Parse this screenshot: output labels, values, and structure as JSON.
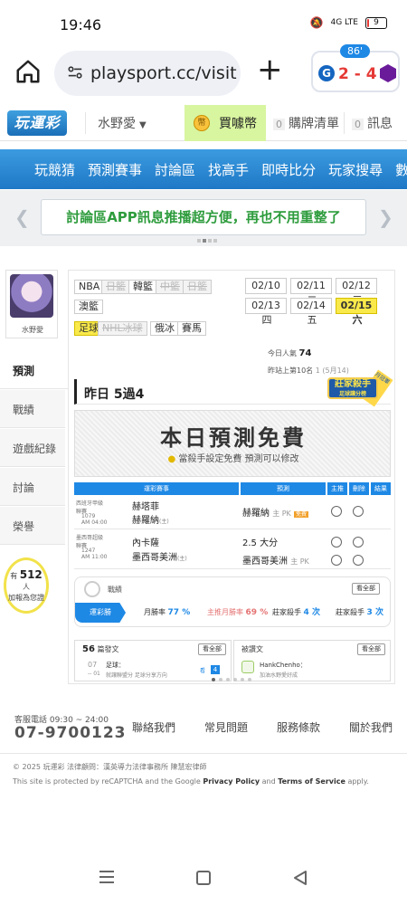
{
  "status_bar": {
    "time": "19:46",
    "battery": "9",
    "battery_level": 0.09,
    "signal_text": "4G LTE"
  },
  "browser": {
    "url": "playsport.cc/visit",
    "score": {
      "minute": "86'",
      "home_score": "2",
      "away_score": "4",
      "home_logo": "G"
    }
  },
  "header": {
    "logo_text": "玩運彩",
    "username": "水野愛",
    "coin_label": "買噱幣",
    "cart_count": "0",
    "cart_label": "購牌清單",
    "msg_count": "0",
    "msg_label": "訊息"
  },
  "nav": {
    "items": [
      {
        "label": "玩競猜"
      },
      {
        "label": "預測賽事"
      },
      {
        "label": "討論區"
      },
      {
        "label": "找高手"
      },
      {
        "label": "即時比分"
      },
      {
        "label": "玩家搜尋"
      },
      {
        "label": "數據"
      }
    ]
  },
  "banner": {
    "text": "討論區APP訊息推播超方便，再也不用重整了"
  },
  "sidebar": {
    "username": "水野愛",
    "items": [
      {
        "label": "預測",
        "active": true
      },
      {
        "label": "戰績",
        "active": false
      },
      {
        "label": "遊戲紀錄",
        "active": false
      },
      {
        "label": "討論",
        "active": false
      },
      {
        "label": "榮譽",
        "active": false
      }
    ],
    "online_prefix": "有",
    "online_count": "512",
    "online_unit": "人",
    "online_suffix": "加報為您證"
  },
  "categories": [
    {
      "label": "NBA",
      "state": "normal"
    },
    {
      "label": "日籃",
      "state": "disabled"
    },
    {
      "label": "韓籃",
      "state": "normal"
    },
    {
      "label": "中籃",
      "state": "disabled"
    },
    {
      "label": "日籃",
      "state": "disabled"
    },
    {
      "label": "澳籃",
      "state": "normal"
    },
    {
      "label": "足球",
      "state": "selected"
    },
    {
      "label": "NHL冰球",
      "state": "disabled"
    },
    {
      "label": "俄冰",
      "state": "normal"
    },
    {
      "label": "賽馬",
      "state": "normal"
    }
  ],
  "dates": [
    {
      "date": "02/10",
      "day": "一",
      "selected": false
    },
    {
      "date": "02/11",
      "day": "二",
      "selected": false
    },
    {
      "date": "02/12",
      "day": "三",
      "selected": false
    },
    {
      "date": "02/13",
      "day": "四",
      "selected": false
    },
    {
      "date": "02/14",
      "day": "五",
      "selected": false
    },
    {
      "date": "02/15",
      "day": "六",
      "selected": true
    }
  ],
  "stats": {
    "today_label": "今日人氣",
    "today_value": "74",
    "rank_label": "昨站上第10名",
    "rank_extra": "1 (5月14)"
  },
  "yesterday": {
    "text": "昨日 5過4"
  },
  "badge": {
    "line1": "莊家殺手",
    "line2": "足球讓分榜",
    "ribbon": "月冠軍榜"
  },
  "free_box": {
    "title": "本日預測免費",
    "subtitle": "當殺手設定免費  預測可以修改"
  },
  "table": {
    "headers": [
      "運彩賽事",
      "預測",
      "主推",
      "刪除",
      "結果"
    ],
    "rows": [
      {
        "league": "西班牙甲級聯賽",
        "id_time": "1079\nAM 04:00",
        "home": "赫塔菲",
        "away": "赫羅納",
        "away_tag": "(主)",
        "pick": "赫羅納",
        "pick_tag": "主 PK",
        "badge": "免費"
      },
      {
        "league": "墨西哥超級聯賽",
        "id_time": "1247\nAM 11:00",
        "home": "內卡薩",
        "away": "墨西哥美洲",
        "away_tag": "(主)",
        "pick": "2.5 大分",
        "pick2": "墨西哥美洲",
        "pick2_tag": "主 PK"
      }
    ]
  },
  "record": {
    "label": "戰績",
    "see_all": "看全部",
    "tags": [
      {
        "label": "運彩勝",
        "value": ""
      },
      {
        "label": "月勝率",
        "value": "77 %"
      },
      {
        "label": "主推月勝率",
        "value": "69 %"
      },
      {
        "label": "莊家殺手",
        "value": "4 次"
      },
      {
        "label": "莊家殺手",
        "value": "3 次"
      }
    ]
  },
  "articles": {
    "count": "56",
    "label": "篇發文",
    "see_all": "看全部",
    "item_num": "07",
    "item_sub": "-- 01",
    "item_title": "足球：",
    "item_desc": "就讓聯盟分 足球分享方向",
    "item_count": "4",
    "item_count_label": "看"
  },
  "invite": {
    "label": "被讚文",
    "see_all": "看全部",
    "user": "HankChenho：",
    "desc": "加油水野愛好成"
  },
  "footer": {
    "service_label": "客服電話 09:30 ~ 24:00",
    "phone": "07-9700123",
    "links": [
      "聯絡我們",
      "常見問題",
      "服務條款",
      "關於我們"
    ],
    "copyright": "© 2025 玩運彩 法律顧問：漢英導力法律事務所 陳慧宏律師",
    "recaptcha_prefix": "This site is protected by reCAPTCHA and the Google ",
    "privacy": "Privacy Policy",
    "and": " and ",
    "terms": "Terms of Service",
    "apply": " apply."
  },
  "colors": {
    "brand_blue": "#1e88e5",
    "highlight_yellow": "#f9e94a",
    "banner_green": "#2e9c3d",
    "score_red": "#e53935"
  }
}
